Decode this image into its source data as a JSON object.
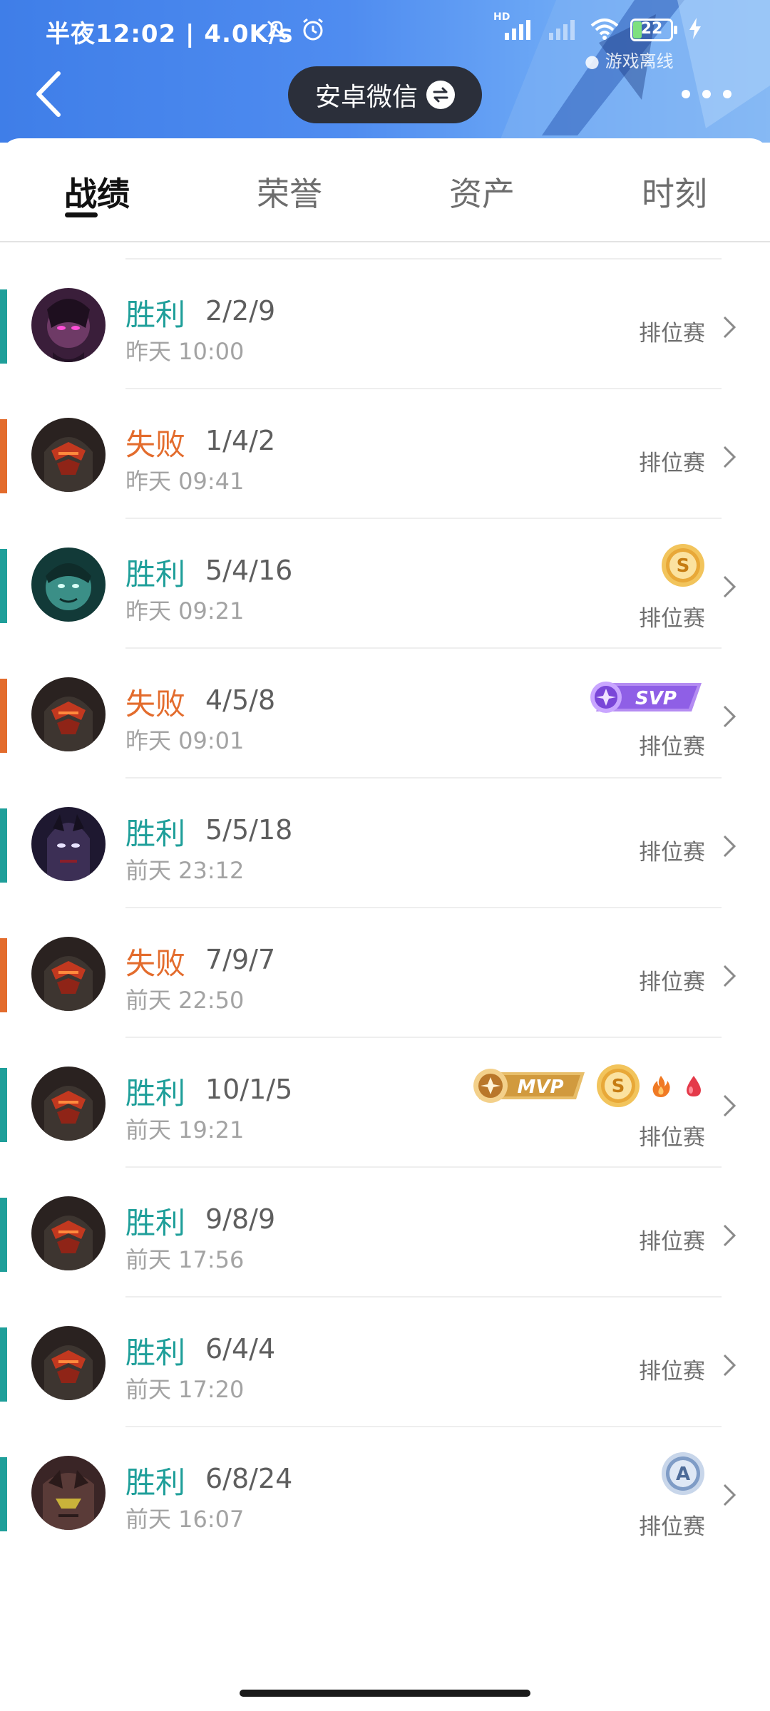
{
  "status_bar": {
    "text": "半夜12:02 | 4.0K/s",
    "network_label": "HD",
    "battery": "22",
    "game_status": "游戏离线"
  },
  "header": {
    "account_label": "安卓微信"
  },
  "tabs": [
    {
      "label": "战绩",
      "active": true
    },
    {
      "label": "荣誉",
      "active": false
    },
    {
      "label": "资产",
      "active": false
    },
    {
      "label": "时刻",
      "active": false
    }
  ],
  "colors": {
    "win": "#1f9f9a",
    "lose": "#e36c2d",
    "header_blue": "#3f7ee8"
  },
  "matches": [
    {
      "result": "胜利",
      "kda": "2/2/9",
      "time": "昨天 10:00",
      "mode": "排位赛",
      "badges": []
    },
    {
      "result": "失败",
      "kda": "1/4/2",
      "time": "昨天 09:41",
      "mode": "排位赛",
      "badges": []
    },
    {
      "result": "胜利",
      "kda": "5/4/16",
      "time": "昨天 09:21",
      "mode": "排位赛",
      "badges": [
        "S"
      ]
    },
    {
      "result": "失败",
      "kda": "4/5/8",
      "time": "昨天 09:01",
      "mode": "排位赛",
      "badges": [
        "SVP"
      ]
    },
    {
      "result": "胜利",
      "kda": "5/5/18",
      "time": "前天 23:12",
      "mode": "排位赛",
      "badges": []
    },
    {
      "result": "失败",
      "kda": "7/9/7",
      "time": "前天 22:50",
      "mode": "排位赛",
      "badges": []
    },
    {
      "result": "胜利",
      "kda": "10/1/5",
      "time": "前天 19:21",
      "mode": "排位赛",
      "badges": [
        "MVP",
        "S",
        "fire",
        "blood"
      ]
    },
    {
      "result": "胜利",
      "kda": "9/8/9",
      "time": "前天 17:56",
      "mode": "排位赛",
      "badges": []
    },
    {
      "result": "胜利",
      "kda": "6/4/4",
      "time": "前天 17:20",
      "mode": "排位赛",
      "badges": []
    },
    {
      "result": "胜利",
      "kda": "6/8/24",
      "time": "前天 16:07",
      "mode": "排位赛",
      "badges": [
        "A"
      ]
    }
  ]
}
